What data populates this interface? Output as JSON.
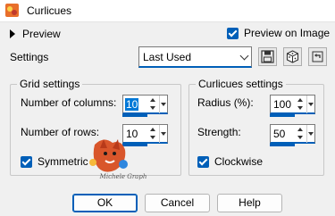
{
  "window": {
    "title": "Curlicues"
  },
  "preview": {
    "label": "Preview",
    "preview_on_image_label": "Preview on Image",
    "preview_on_image_checked": true
  },
  "settings": {
    "label": "Settings",
    "preset_value": "Last Used"
  },
  "grid": {
    "title": "Grid settings",
    "columns_label": "Number of columns:",
    "columns_value": "10",
    "rows_label": "Number of rows:",
    "rows_value": "10",
    "symmetric_label": "Symmetric",
    "symmetric_checked": true
  },
  "curlicues": {
    "title": "Curlicues settings",
    "radius_label": "Radius (%):",
    "radius_value": "100",
    "strength_label": "Strength:",
    "strength_value": "50",
    "clockwise_label": "Clockwise",
    "clockwise_checked": true
  },
  "buttons": {
    "ok": "OK",
    "cancel": "Cancel",
    "help": "Help"
  },
  "watermark": {
    "text": "Michele Graph"
  },
  "colors": {
    "accent": "#005fb8",
    "selection": "#0078d7"
  }
}
